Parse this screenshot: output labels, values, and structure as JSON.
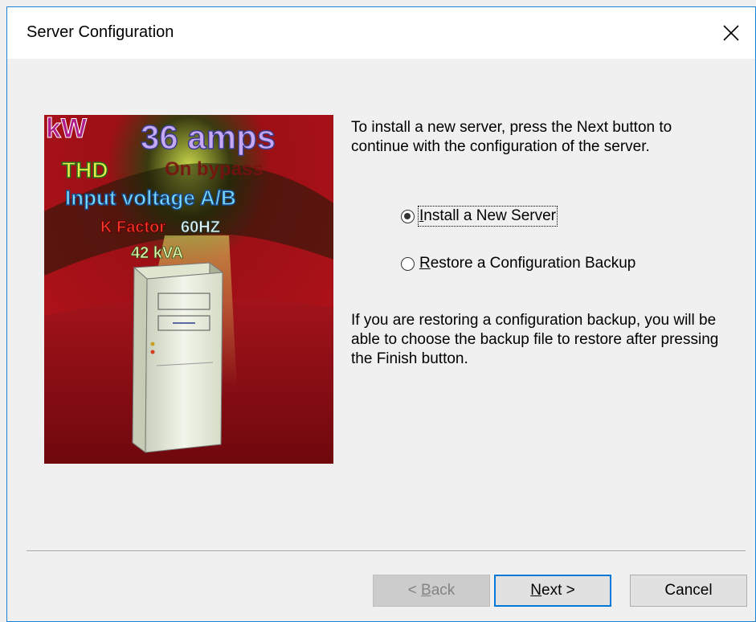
{
  "window": {
    "title": "Server Configuration",
    "close_icon": "close-icon"
  },
  "illustration": {
    "texts": [
      "kW",
      "36 amps",
      "THD",
      "On bypass",
      "Input voltage A/B",
      "K Factor",
      "60HZ",
      "42 kVA"
    ],
    "colors": {
      "background": "#b3121a",
      "floor": "#8a0c12",
      "tower": "#e8ede0"
    }
  },
  "content": {
    "intro": "To install a new server, press the Next button to continue with the configuration of the server.",
    "options": [
      {
        "label": "Install a New Server",
        "accesskey": "I",
        "rest": "nstall a New Server",
        "selected": true
      },
      {
        "label": "Restore a Configuration Backup",
        "accesskey": "R",
        "rest": "estore a Configuration Backup",
        "selected": false
      }
    ],
    "note": "If you are restoring a configuration backup, you will be able to choose the backup file to restore after pressing the Finish button."
  },
  "buttons": {
    "back": {
      "prefix": "< ",
      "accesskey": "B",
      "rest": "ack",
      "enabled": false
    },
    "next": {
      "accesskey": "N",
      "rest": "ext >",
      "default": true
    },
    "cancel": {
      "label": "Cancel"
    }
  },
  "colors": {
    "accent": "#0078d7",
    "window_border": "#1883d7",
    "dialog_bg": "#f0f0f0"
  }
}
